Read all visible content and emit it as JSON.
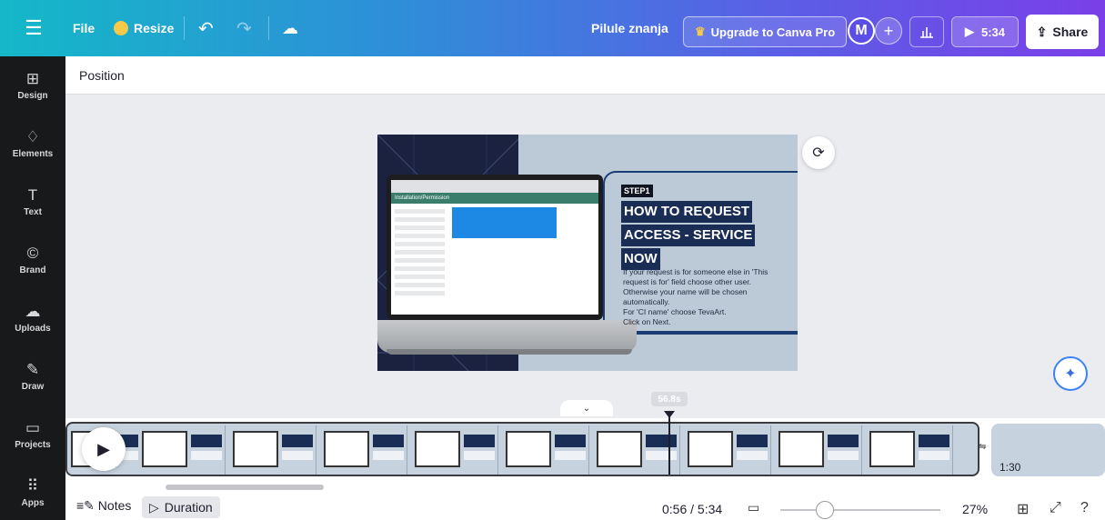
{
  "topbar": {
    "file_label": "File",
    "resize_label": "Resize",
    "design_title": "Pilule znanja",
    "upgrade_label": "Upgrade to Canva Pro",
    "avatar_initial": "M",
    "present_label": "5:34",
    "share_label": "Share"
  },
  "sidebar": {
    "items": [
      {
        "label": "Design",
        "icon": "design-icon"
      },
      {
        "label": "Elements",
        "icon": "elements-icon"
      },
      {
        "label": "Text",
        "icon": "text-icon"
      },
      {
        "label": "Brand",
        "icon": "brand-icon"
      },
      {
        "label": "Uploads",
        "icon": "uploads-icon"
      },
      {
        "label": "Draw",
        "icon": "draw-icon"
      },
      {
        "label": "Projects",
        "icon": "projects-icon"
      },
      {
        "label": "Apps",
        "icon": "apps-icon"
      }
    ]
  },
  "toolbar": {
    "position_label": "Position"
  },
  "slide": {
    "step": "STEP1",
    "heading_lines": [
      "HOW TO REQUEST",
      "ACCESS - SERVICE",
      "NOW"
    ],
    "body": "If your request is for someone else in 'This request is for' field choose other user. Otherwise your name will be chosen automatically.\nFor 'CI name' choose TevaArt.\nClick on Next.",
    "web_title": "Installation/Permission"
  },
  "timeline": {
    "current_marker": "56.8s",
    "next_duration": "1:30"
  },
  "footer": {
    "notes_label": "Notes",
    "duration_label": "Duration",
    "time": "0:56 / 5:34",
    "zoom": "27%"
  }
}
